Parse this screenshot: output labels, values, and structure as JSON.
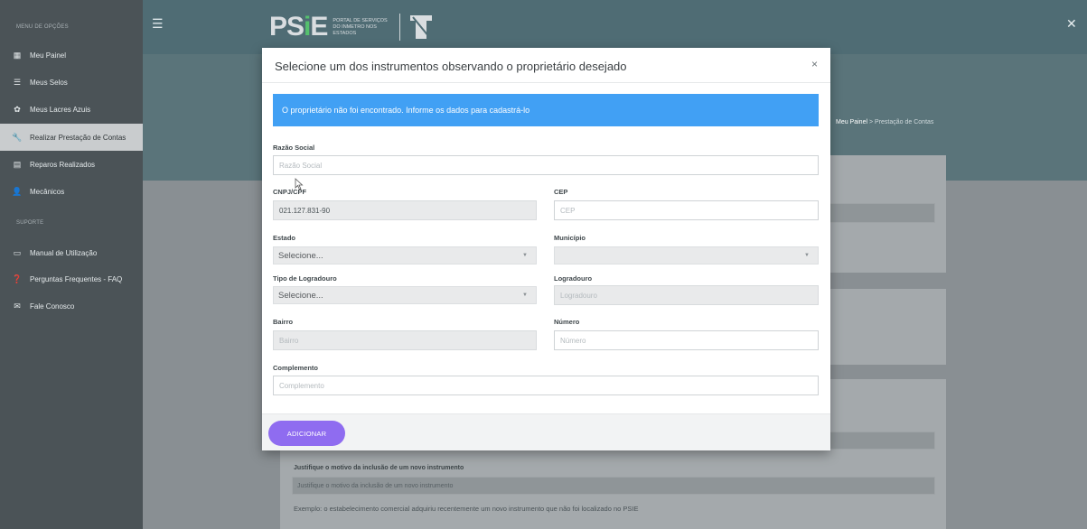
{
  "sidebar": {
    "section_menu": "MENU DE OPÇÕES",
    "section_support": "SUPORTE",
    "items": [
      {
        "label": "Meu Painel",
        "icon": "dashboard-icon"
      },
      {
        "label": "Meus Selos",
        "icon": "table-icon"
      },
      {
        "label": "Meus Lacres Azuis",
        "icon": "seal-icon"
      },
      {
        "label": "Realizar Prestação de Contas",
        "icon": "wrench-icon"
      },
      {
        "label": "Reparos Realizados",
        "icon": "document-icon"
      },
      {
        "label": "Mecânicos",
        "icon": "user-icon"
      }
    ],
    "support_items": [
      {
        "label": "Manual de Utilização",
        "icon": "book-icon"
      },
      {
        "label": "Perguntas Frequentes - FAQ",
        "icon": "question-icon"
      },
      {
        "label": "Fale Conosco",
        "icon": "envelope-icon"
      }
    ]
  },
  "header": {
    "logo_text_left": "PS",
    "logo_text_accent": "i",
    "logo_text_right": "E",
    "logo_tagline_1": "PORTAL DE SERVIÇOS",
    "logo_tagline_2": "DO INMETRO NOS ESTADOS",
    "colors": {
      "topbar": "#4f6c74",
      "sidebar": "#4b5357",
      "accent": "#8f6cf0",
      "alert": "#41a0f4"
    }
  },
  "breadcrumb": {
    "home": "Meu Painel",
    "sep": ">",
    "current": "Prestação de Contas"
  },
  "background": {
    "justify_label": "Justifique o motivo da inclusão de um novo instrumento",
    "justify_placeholder": "Justifique o motivo da inclusão de um novo instrumento",
    "example_text": "Exemplo: o estabelecimento comercial adquiriu recentemente um novo instrumento que não foi localizado no PSIE"
  },
  "modal": {
    "title": "Selecione um dos instrumentos observando o proprietário desejado",
    "close": "×",
    "alert": "O proprietário não foi encontrado. Informe os dados para cadastrá-lo",
    "fields": {
      "razao_social": {
        "label": "Razão Social",
        "placeholder": "Razão Social"
      },
      "cnpj": {
        "label": "CNPJ/CPF",
        "value": "021.127.831-90"
      },
      "cep": {
        "label": "CEP",
        "placeholder": "CEP"
      },
      "estado": {
        "label": "Estado",
        "value": "Selecione..."
      },
      "municipio": {
        "label": "Município",
        "value": ""
      },
      "tipo_logradouro": {
        "label": "Tipo de Logradouro",
        "value": "Selecione..."
      },
      "logradouro": {
        "label": "Logradouro",
        "placeholder": "Logradouro"
      },
      "bairro": {
        "label": "Bairro",
        "placeholder": "Bairro"
      },
      "numero": {
        "label": "Número",
        "placeholder": "Número"
      },
      "complemento": {
        "label": "Complemento",
        "placeholder": "Complemento"
      }
    },
    "add_button": "ADICIONAR"
  }
}
